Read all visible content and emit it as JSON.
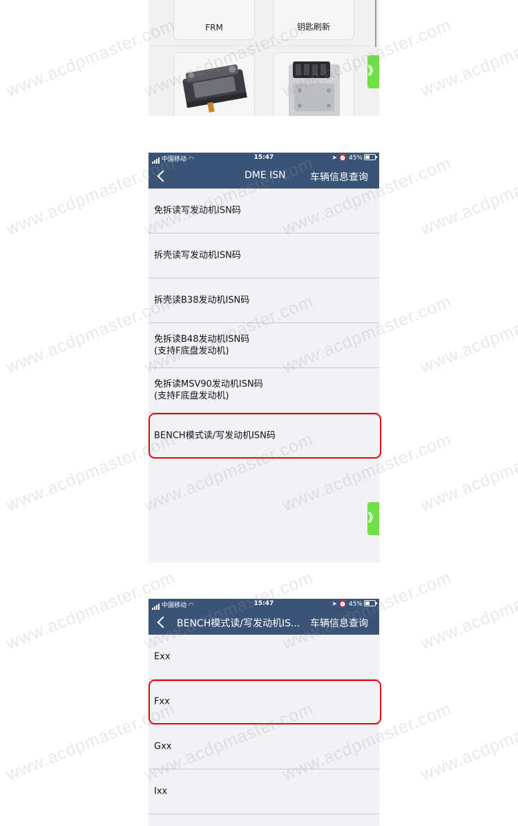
{
  "watermark_text": "www.acdpmaster.com",
  "panel1": {
    "tiles": [
      {
        "label": "FRM"
      },
      {
        "label": "钥匙刷新"
      }
    ],
    "side_tab": {
      "label": "》",
      "color": "#6fe047"
    }
  },
  "screen_dme": {
    "status_bar": {
      "carrier": "中国移动",
      "time": "15:47",
      "battery": "45%"
    },
    "nav": {
      "back_icon": "chevron-left-icon",
      "title": "DME ISN",
      "right_action": "车辆信息查询"
    },
    "items": [
      {
        "lines": [
          "免拆读写发动机ISN码"
        ]
      },
      {
        "lines": [
          "拆壳读写发动机ISN码"
        ]
      },
      {
        "lines": [
          "拆壳读B38发动机ISN码"
        ]
      },
      {
        "lines": [
          "免拆读B48发动机ISN码",
          "(支持F底盘发动机)"
        ]
      },
      {
        "lines": [
          "免拆读MSV90发动机ISN码",
          "(支持F底盘发动机)"
        ]
      },
      {
        "lines": [
          "BENCH模式读/写发动机ISN码"
        ]
      }
    ],
    "highlighted_item": "BENCH模式读/写发动机ISN码",
    "side_tab": {
      "label": "》"
    }
  },
  "screen_bench": {
    "status_bar": {
      "carrier": "中国移动",
      "time": "15:47",
      "battery": "45%"
    },
    "nav": {
      "back_icon": "chevron-left-icon",
      "title": "BENCH模式读/写发动机IS...",
      "right_action": "车辆信息查询"
    },
    "items": [
      {
        "lines": [
          "Exx"
        ]
      },
      {
        "lines": [
          "Fxx"
        ]
      },
      {
        "lines": [
          "Gxx"
        ]
      },
      {
        "lines": [
          "Ixx"
        ]
      }
    ],
    "highlighted_item": "Fxx"
  },
  "colors": {
    "navbar": "#3a5478",
    "highlight": "#e60012",
    "side_tab": "#6fe047"
  }
}
